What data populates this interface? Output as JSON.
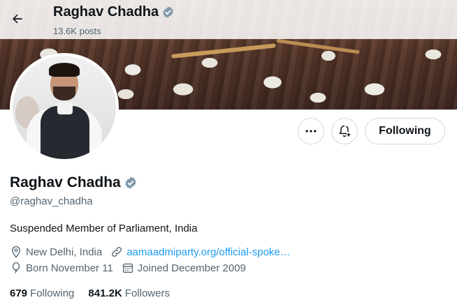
{
  "header": {
    "name": "Raghav Chadha",
    "posts": "13.6K posts"
  },
  "banner": {
    "description_icon": "crowd-photo"
  },
  "profile": {
    "name": "Raghav Chadha",
    "handle": "@raghav_chadha",
    "bio": "Suspended Member of Parliament, India",
    "location": "New Delhi, India",
    "website": "aamaadmiparty.org/official-spoke…",
    "birthday": "Born November 11",
    "joined": "Joined December 2009"
  },
  "actions": {
    "follow_label": "Following"
  },
  "stats": {
    "following_count": "679",
    "following_label": "Following",
    "followers_count": "841.2K",
    "followers_label": "Followers"
  },
  "colors": {
    "verified": "#829aab",
    "link": "#1d9bf0",
    "muted": "#536471",
    "text": "#0f1419"
  }
}
